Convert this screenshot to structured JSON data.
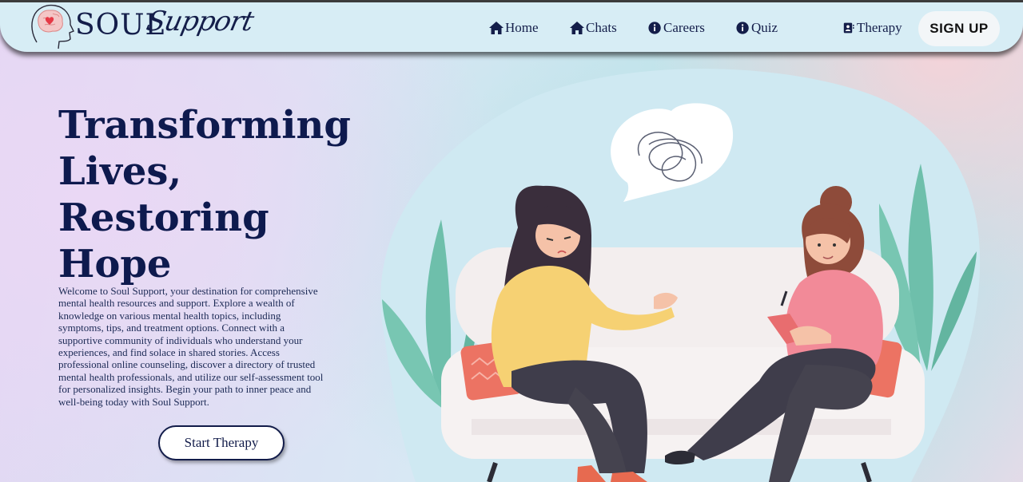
{
  "brand": {
    "name_a": "SOUL",
    "name_b": "Support"
  },
  "nav": {
    "items": [
      {
        "label": "Home",
        "icon": "home-icon"
      },
      {
        "label": "Chats",
        "icon": "home-icon"
      },
      {
        "label": "Careers",
        "icon": "info-icon"
      },
      {
        "label": "Quiz",
        "icon": "info-icon"
      },
      {
        "label": "Therapy",
        "icon": "contact-card-icon"
      }
    ],
    "signup_label": "SIGN UP"
  },
  "hero": {
    "title_lines": [
      "Transforming",
      "Lives,",
      "Restoring",
      "Hope"
    ],
    "description": "Welcome to Soul Support, your destination for comprehensive mental health resources and support. Explore a wealth of knowledge on various mental health topics, including symptoms, tips, and treatment options. Connect with a supportive community of individuals who understand your experiences, and find solace in shared stories. Access professional online counseling, discover a directory of trusted mental health professionals, and utilize our self-assessment tool for personalized insights. Begin your path to inner peace and well-being today with Soul Support.",
    "cta_label": "Start Therapy"
  },
  "colors": {
    "navy": "#141e4a",
    "navbar_bg": "#d7edf5",
    "blob": "#cfe9f2",
    "leaf": "#6ebfab",
    "sofa": "#f3eeee",
    "cushion": "#ec7363",
    "sweater_yellow": "#f6d173",
    "sweater_pink": "#f28a98"
  }
}
